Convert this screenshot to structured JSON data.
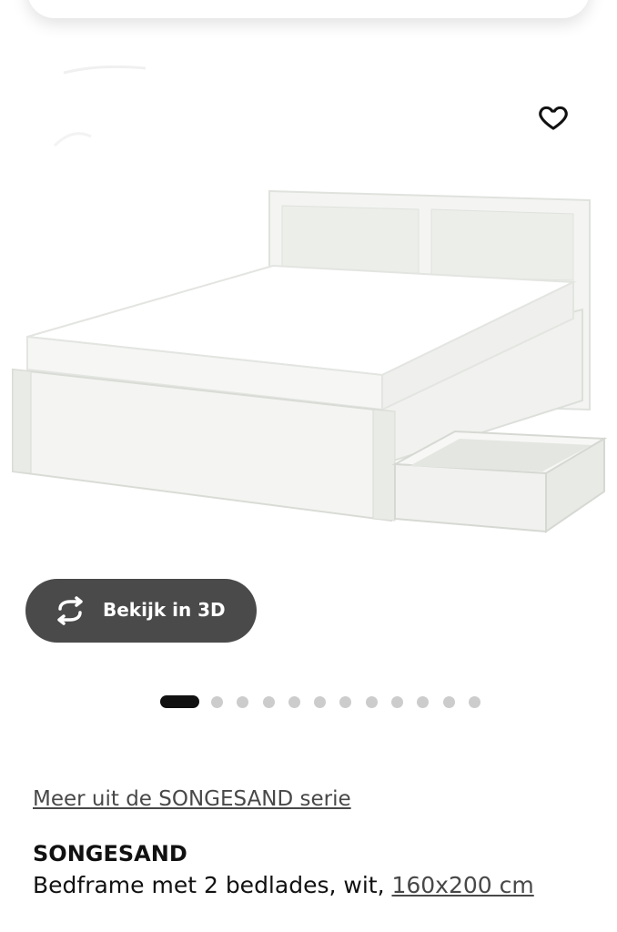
{
  "product": {
    "image_alt": "SONGESAND bedframe",
    "wishlist_icon": "heart-outline-icon",
    "view_3d_label": "Bekijk in 3D",
    "view_3d_icon": "rotate-3d-icon",
    "carousel": {
      "total": 12,
      "active_index": 0
    },
    "series_link": "Meer uit de SONGESAND serie",
    "name": "SONGESAND",
    "description_prefix": "Bedframe met 2 bedlades, wit, ",
    "size_link": "160x200 cm"
  },
  "colors": {
    "button_bg": "#4a4a4a",
    "dot_active": "#111111",
    "dot_inactive": "#cccccc",
    "link": "#484848"
  }
}
